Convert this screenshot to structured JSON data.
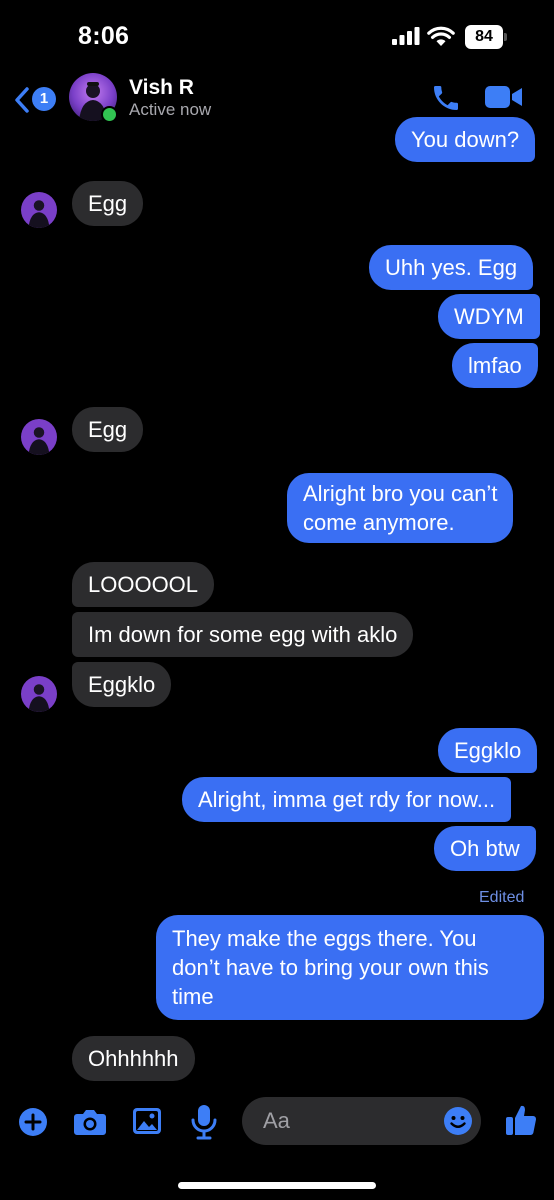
{
  "status_bar": {
    "time": "8:06",
    "battery": "84"
  },
  "header": {
    "back_badge": "1",
    "contact_name": "Vish R",
    "contact_status": "Active now"
  },
  "messages": [
    {
      "dir": "out",
      "text": "You down?"
    },
    {
      "dir": "in",
      "text": "Egg"
    },
    {
      "dir": "out",
      "text": "Uhh yes. Egg"
    },
    {
      "dir": "out",
      "text": "WDYM"
    },
    {
      "dir": "out",
      "text": "lmfao"
    },
    {
      "dir": "in",
      "text": "Egg"
    },
    {
      "dir": "out",
      "text": "Alright bro you can’t\ncome anymore."
    },
    {
      "dir": "in",
      "text": "LOOOOOL"
    },
    {
      "dir": "in",
      "text": "Im down for some egg with aklo"
    },
    {
      "dir": "in",
      "text": "Eggklo"
    },
    {
      "dir": "out",
      "text": "Eggklo"
    },
    {
      "dir": "out",
      "text": "Alright, imma get rdy for now..."
    },
    {
      "dir": "out",
      "text": "Oh btw"
    },
    {
      "dir": "out",
      "text": "They make the eggs there. You\ndon’t have to bring your own this\ntime"
    },
    {
      "dir": "in",
      "text": "Ohhhhhh"
    }
  ],
  "edited_label": "Edited",
  "composer": {
    "placeholder": "Aa"
  },
  "colors": {
    "outgoing": "#3a6ff3",
    "incoming": "#2c2c2e",
    "accent": "#3d7ef6"
  },
  "icons": [
    "back-chevron-icon",
    "phone-icon",
    "video-camera-icon",
    "plus-icon",
    "camera-icon",
    "photo-icon",
    "microphone-icon",
    "emoji-icon",
    "thumbs-up-icon"
  ]
}
